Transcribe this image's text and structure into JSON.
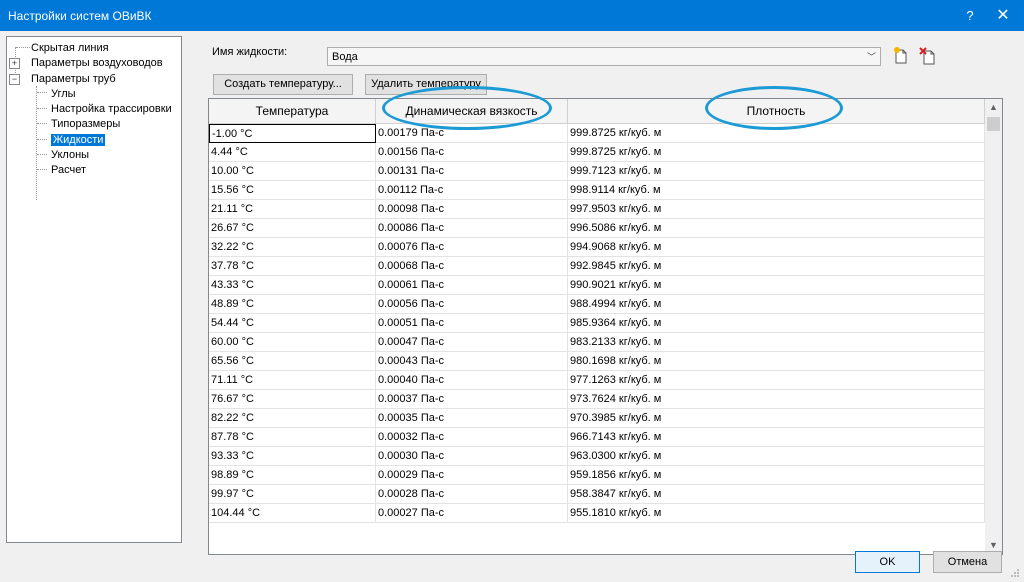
{
  "window": {
    "title": "Настройки систем ОВиВК",
    "help_label": "?",
    "close_label": "✕"
  },
  "tree": {
    "items": [
      {
        "label": "Скрытая линия",
        "expander": ""
      },
      {
        "label": "Параметры воздуховодов",
        "expander": "+"
      },
      {
        "label": "Параметры труб",
        "expander": "−"
      },
      {
        "label": "Углы",
        "expander": ""
      },
      {
        "label": "Настройка трассировки",
        "expander": ""
      },
      {
        "label": "Типоразмеры",
        "expander": ""
      },
      {
        "label": "Жидкости",
        "expander": "",
        "selected": true
      },
      {
        "label": "Уклоны",
        "expander": ""
      },
      {
        "label": "Расчет",
        "expander": ""
      }
    ]
  },
  "fluid": {
    "label": "Имя жидкости:",
    "value": "Вода",
    "chevron": "﹀"
  },
  "buttons": {
    "create": "Создать температуру...",
    "delete": "Удалить температуру",
    "ok": "OK",
    "cancel": "Отмена"
  },
  "table": {
    "headers": [
      "Температура",
      "Динамическая вязкость",
      "Плотность"
    ],
    "rows": [
      [
        "-1.00 °C",
        "0.00179 Па-с",
        "999.8725 кг/куб. м"
      ],
      [
        "4.44 °C",
        "0.00156 Па-с",
        "999.8725 кг/куб. м"
      ],
      [
        "10.00 °C",
        "0.00131 Па-с",
        "999.7123 кг/куб. м"
      ],
      [
        "15.56 °C",
        "0.00112 Па-с",
        "998.9114 кг/куб. м"
      ],
      [
        "21.11 °C",
        "0.00098 Па-с",
        "997.9503 кг/куб. м"
      ],
      [
        "26.67 °C",
        "0.00086 Па-с",
        "996.5086 кг/куб. м"
      ],
      [
        "32.22 °C",
        "0.00076 Па-с",
        "994.9068 кг/куб. м"
      ],
      [
        "37.78 °C",
        "0.00068 Па-с",
        "992.9845 кг/куб. м"
      ],
      [
        "43.33 °C",
        "0.00061 Па-с",
        "990.9021 кг/куб. м"
      ],
      [
        "48.89 °C",
        "0.00056 Па-с",
        "988.4994 кг/куб. м"
      ],
      [
        "54.44 °C",
        "0.00051 Па-с",
        "985.9364 кг/куб. м"
      ],
      [
        "60.00 °C",
        "0.00047 Па-с",
        "983.2133 кг/куб. м"
      ],
      [
        "65.56 °C",
        "0.00043 Па-с",
        "980.1698 кг/куб. м"
      ],
      [
        "71.11 °C",
        "0.00040 Па-с",
        "977.1263 кг/куб. м"
      ],
      [
        "76.67 °C",
        "0.00037 Па-с",
        "973.7624 кг/куб. м"
      ],
      [
        "82.22 °C",
        "0.00035 Па-с",
        "970.3985 кг/куб. м"
      ],
      [
        "87.78 °C",
        "0.00032 Па-с",
        "966.7143 кг/куб. м"
      ],
      [
        "93.33 °C",
        "0.00030 Па-с",
        "963.0300 кг/куб. м"
      ],
      [
        "98.89 °C",
        "0.00029 Па-с",
        "959.1856 кг/куб. м"
      ],
      [
        "99.97 °C",
        "0.00028 Па-с",
        "958.3847 кг/куб. м"
      ],
      [
        "104.44 °C",
        "0.00027 Па-с",
        "955.1810 кг/куб. м"
      ]
    ]
  },
  "scrollbar": {
    "up_arrow": "▲",
    "down_arrow": "▼"
  },
  "colors": {
    "titlebar": "#0078d7",
    "selection": "#0078d7",
    "highlight_ellipse": "#1b9ad6"
  }
}
